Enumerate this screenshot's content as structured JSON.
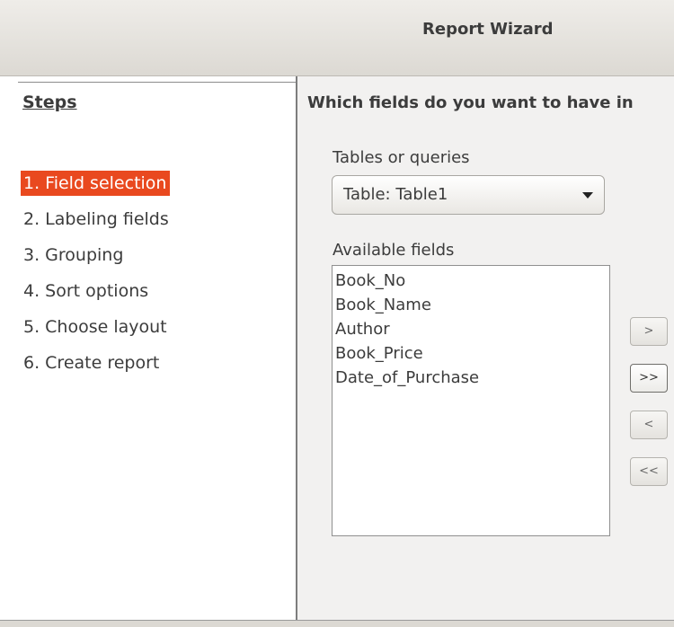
{
  "window": {
    "title": "Report Wizard"
  },
  "steps": {
    "heading": "Steps",
    "items": [
      {
        "label": "1. Field selection",
        "active": true
      },
      {
        "label": "2. Labeling fields",
        "active": false
      },
      {
        "label": "3. Grouping",
        "active": false
      },
      {
        "label": "4. Sort options",
        "active": false
      },
      {
        "label": "5. Choose layout",
        "active": false
      },
      {
        "label": "6. Create report",
        "active": false
      }
    ]
  },
  "main": {
    "question": "Which fields do you want to have in",
    "tables_label": "Tables or queries",
    "table_select": {
      "value": "Table: Table1"
    },
    "available_label": "Available fields",
    "available_fields": [
      "Book_No",
      "Book_Name",
      "Author",
      "Book_Price",
      "Date_of_Purchase"
    ],
    "buttons": {
      "add_one": ">",
      "add_all": ">>",
      "remove_one": "<",
      "remove_all": "<<"
    }
  },
  "colors": {
    "active_step_bg": "#e9491f",
    "active_step_text": "#ffffff"
  }
}
